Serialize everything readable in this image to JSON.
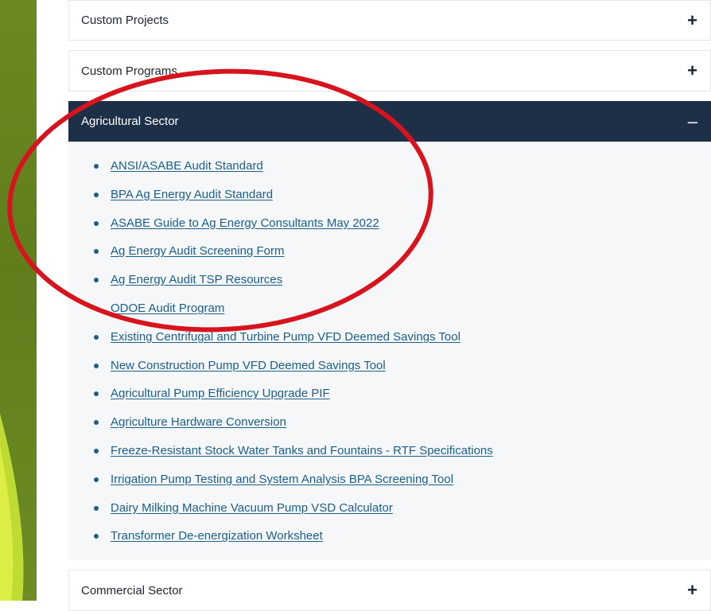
{
  "accordion": {
    "sections": [
      {
        "title": "Custom Projects",
        "toggle": "+"
      },
      {
        "title": "Custom Programs",
        "toggle": "+"
      },
      {
        "title": "Agricultural Sector",
        "toggle": "–"
      },
      {
        "title": "Commercial Sector",
        "toggle": "+"
      }
    ],
    "agricultural_links": [
      "ANSI/ASABE Audit Standard",
      "BPA Ag Energy Audit Standard",
      "ASABE Guide to Ag Energy Consultants May 2022",
      "Ag Energy Audit Screening Form",
      "Ag Energy Audit TSP Resources",
      "ODOE Audit Program",
      "Existing Centrifugal and Turbine Pump VFD Deemed Savings Tool",
      "New Construction Pump VFD Deemed Savings Tool",
      "Agricultural Pump Efficiency Upgrade PIF",
      "Agriculture Hardware Conversion",
      "Freeze-Resistant Stock Water Tanks and Fountains - RTF Specifications",
      "Irrigation Pump Testing and System Analysis BPA Screening Tool",
      "Dairy Milking Machine Vacuum Pump VSD Calculator",
      "Transformer De-energization Worksheet"
    ]
  },
  "colors": {
    "header_active": "#1e2f48",
    "link": "#1a5e8a",
    "annotation": "#d7141e",
    "side_green": "#6c8a22"
  }
}
